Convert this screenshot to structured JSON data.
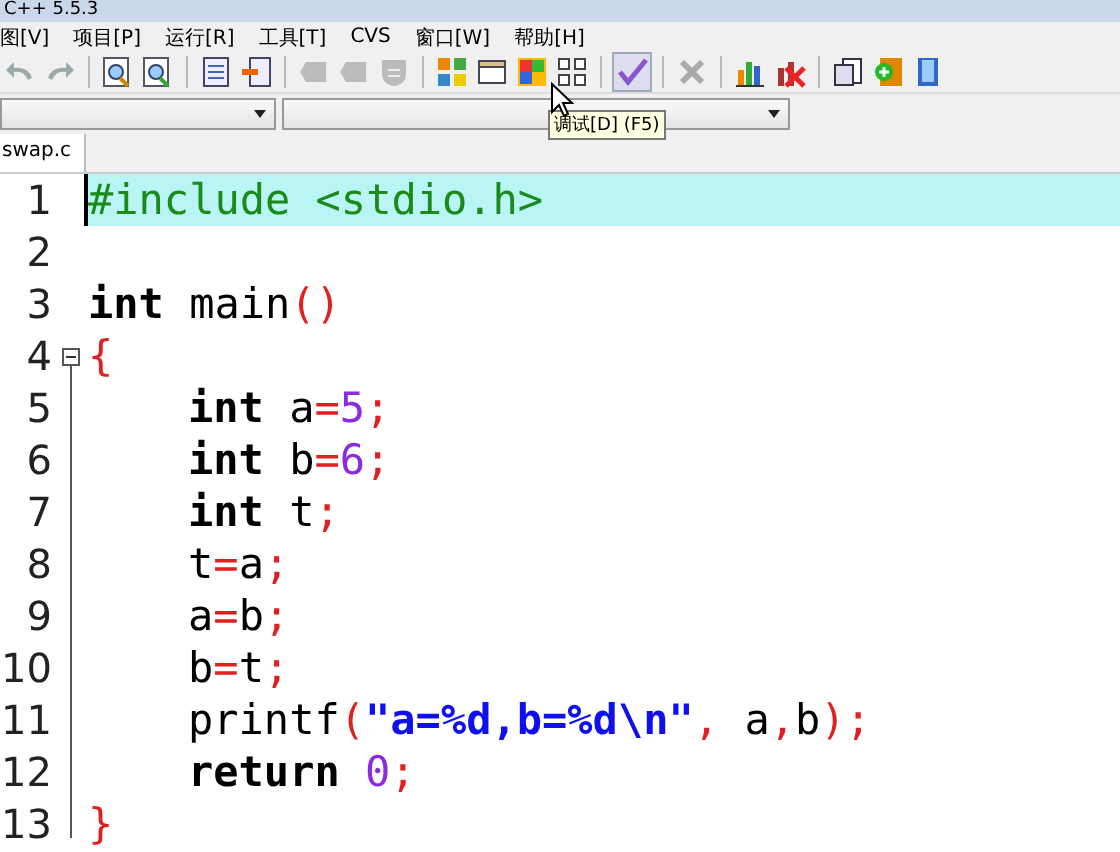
{
  "window": {
    "title": "C++ 5.5.3"
  },
  "menu": [
    "图[V]",
    "项目[P]",
    "运行[R]",
    "工具[T]",
    "CVS",
    "窗口[W]",
    "帮助[H]"
  ],
  "tooltip": "调试[D] (F5)",
  "tabs": [
    {
      "label": "swap.c",
      "selected": true
    }
  ],
  "editor": {
    "lines": [
      {
        "number": "1",
        "current": true,
        "fold": false,
        "indented": false,
        "tokens": [
          {
            "kind": "pre",
            "text": "#include <stdio.h>"
          }
        ]
      },
      {
        "number": "2",
        "current": false,
        "fold": false
      },
      {
        "number": "3",
        "current": false,
        "fold": false,
        "indented": false,
        "tokens": [
          {
            "kind": "kw",
            "text": "int"
          },
          {
            "kind": "id",
            "text": " main"
          },
          {
            "kind": "op",
            "text": "()"
          }
        ]
      },
      {
        "number": "4",
        "current": false,
        "fold": true,
        "indented": false,
        "tokens": [
          {
            "kind": "op",
            "text": "{"
          }
        ]
      },
      {
        "number": "5",
        "current": false,
        "fold": false,
        "indented": true,
        "tokens": [
          {
            "kind": "kw",
            "text": "int"
          },
          {
            "kind": "id",
            "text": " a"
          },
          {
            "kind": "op",
            "text": "="
          },
          {
            "kind": "num",
            "text": "5"
          },
          {
            "kind": "op",
            "text": ";"
          }
        ]
      },
      {
        "number": "6",
        "current": false,
        "fold": false,
        "indented": true,
        "tokens": [
          {
            "kind": "kw",
            "text": "int"
          },
          {
            "kind": "id",
            "text": " b"
          },
          {
            "kind": "op",
            "text": "="
          },
          {
            "kind": "num",
            "text": "6"
          },
          {
            "kind": "op",
            "text": ";"
          }
        ]
      },
      {
        "number": "7",
        "current": false,
        "fold": false,
        "indented": true,
        "tokens": [
          {
            "kind": "kw",
            "text": "int"
          },
          {
            "kind": "id",
            "text": " t"
          },
          {
            "kind": "op",
            "text": ";"
          }
        ]
      },
      {
        "number": "8",
        "current": false,
        "fold": false,
        "indented": true,
        "tokens": [
          {
            "kind": "id",
            "text": "t"
          },
          {
            "kind": "op",
            "text": "="
          },
          {
            "kind": "id",
            "text": "a"
          },
          {
            "kind": "op",
            "text": ";"
          }
        ]
      },
      {
        "number": "9",
        "current": false,
        "fold": false,
        "indented": true,
        "tokens": [
          {
            "kind": "id",
            "text": "a"
          },
          {
            "kind": "op",
            "text": "="
          },
          {
            "kind": "id",
            "text": "b"
          },
          {
            "kind": "op",
            "text": ";"
          }
        ]
      },
      {
        "number": "10",
        "current": false,
        "fold": false,
        "indented": true,
        "tokens": [
          {
            "kind": "id",
            "text": "b"
          },
          {
            "kind": "op",
            "text": "="
          },
          {
            "kind": "id",
            "text": "t"
          },
          {
            "kind": "op",
            "text": ";"
          }
        ]
      },
      {
        "number": "11",
        "current": false,
        "fold": false,
        "indented": true,
        "tokens": [
          {
            "kind": "id",
            "text": "printf"
          },
          {
            "kind": "op",
            "text": "("
          },
          {
            "kind": "str",
            "text": "\"a=%d,b=%d\\n\""
          },
          {
            "kind": "op",
            "text": ","
          },
          {
            "kind": "id",
            "text": " a"
          },
          {
            "kind": "op",
            "text": ","
          },
          {
            "kind": "id",
            "text": "b"
          },
          {
            "kind": "op",
            "text": ");"
          }
        ]
      },
      {
        "number": "12",
        "current": false,
        "fold": false,
        "indented": true,
        "tokens": [
          {
            "kind": "kw",
            "text": "return"
          },
          {
            "kind": "num",
            "text": " 0"
          },
          {
            "kind": "op",
            "text": ";"
          }
        ]
      },
      {
        "number": "13",
        "current": false,
        "fold": false,
        "indented": false,
        "tokens": [
          {
            "kind": "op",
            "text": "}"
          }
        ]
      }
    ]
  }
}
